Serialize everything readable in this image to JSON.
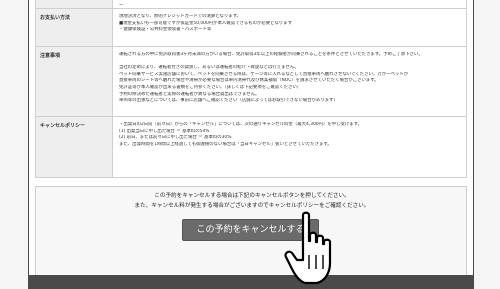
{
  "rows": [
    {
      "label": "",
      "lines": [
        "ー"
      ]
    },
    {
      "label": "お支払い方法",
      "lines": [
        "現地決済となり、原則クレジットカードでの清算となります。",
        "■現金支払いも一部可能ですが保証金50,000円が本人確認できるものが必要となります",
        "・健康保険証・公共料金領収書・パスポート等"
      ]
    },
    {
      "label": "注意事項",
      "lines": [
        "運転される方の中に免許取得後3ヶ月未満の方がいる場合、免許取得3年以上の経験者が同乗されることを条件とさせていただきます。予めご了承下さい。",
        "",
        "当社の定めにより、運転者付きの貸渡し、あるいは運転者の紹介・斡旋などは行えません。",
        "ペット同乗サービス実施店舗において、ペットを同乗させる際は、ゲージ等に入れるなどして直接車両へ触れさせないでください。万が一ペットが",
        "直接車両のシート等へ触れた場合や清掃が必要な場合は車内清掃代及び休業補償（NOC）を請求させていただく場合がございます。",
        "免許証等が本人確認が出来る書類をご持参ください。（詳しくは下記要項をご確認ください）",
        "予約の際決めた運転者と実際の運転者が異なる場合貸出はできません。",
        "車両等の出張などについては、事前に店舗へご確認ください（店舗によってはお取引できない場合があります）"
      ]
    },
    {
      "label": "キャンセルポリシー",
      "lines": [
        "・出発日の2日前（前々日）からの「キャンセル」については、次の通りキャンセル料金（最大4,300円）を申し受けます。",
        "(1) 出発当日に申し出た場合 ＝ 基本料の50%",
        "(2) 前日、または前々日に申し出た場合 ＝ 基本料の30%",
        "また、出発時間を1時間以上経過しても御連絡のない場合は「当日キャンセル」扱いとさせていただきます。"
      ]
    }
  ],
  "notice": {
    "line1": "この予約をキャンセルする場合は下記のキャンセルボタンを押してください。",
    "line2": "また、キャンセル料が発生する場合がございますのでキャンセルポリシーをご確認ください。"
  },
  "cancel_button": {
    "label": "この予約をキャンセルする"
  },
  "colors": {
    "button": "#6b6b6b",
    "frame": "#4a4a4a",
    "label_bg": "#eeeeee"
  },
  "cursor_icon": "hand-pointer-icon"
}
